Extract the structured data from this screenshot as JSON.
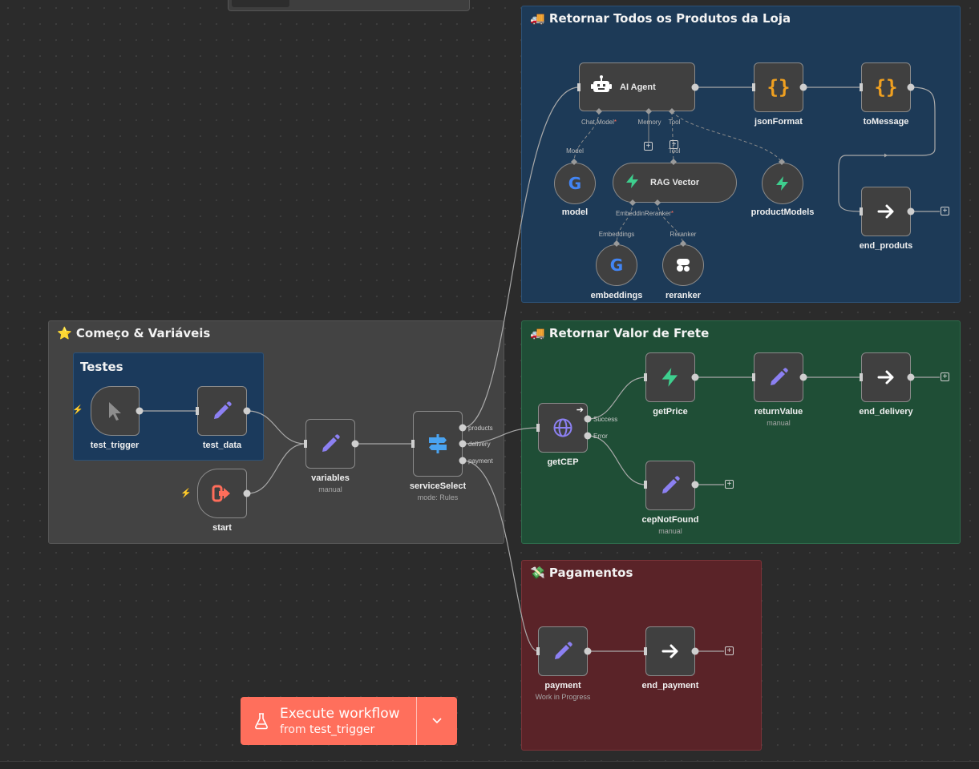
{
  "groups": {
    "products": {
      "emoji": "🚚",
      "title": "Retornar Todos os Produtos da Loja"
    },
    "inicio": {
      "emoji": "⭐",
      "title": "Começo & Variáveis"
    },
    "testes": {
      "title": "Testes"
    },
    "frete": {
      "emoji": "🚚",
      "title": "Retornar Valor de Frete"
    },
    "pagamentos": {
      "emoji": "💸",
      "title": "Pagamentos"
    }
  },
  "nodes": {
    "ai_agent": {
      "label": "AI Agent"
    },
    "json_format": {
      "label": "jsonFormat"
    },
    "to_message": {
      "label": "toMessage"
    },
    "model": {
      "label": "model"
    },
    "rag_vector": {
      "label": "RAG Vector"
    },
    "product_models": {
      "label": "productModels"
    },
    "end_produts": {
      "label": "end_produts"
    },
    "embeddings": {
      "label": "embeddings"
    },
    "reranker": {
      "label": "reranker"
    },
    "test_trigger": {
      "label": "test_trigger"
    },
    "test_data": {
      "label": "test_data"
    },
    "start": {
      "label": "start"
    },
    "variables": {
      "label": "variables",
      "sub": "manual"
    },
    "service_select": {
      "label": "serviceSelect",
      "sub": "mode: Rules"
    },
    "get_cep": {
      "label": "getCEP"
    },
    "get_price": {
      "label": "getPrice"
    },
    "return_value": {
      "label": "returnValue",
      "sub": "manual"
    },
    "end_delivery": {
      "label": "end_delivery"
    },
    "cep_not_found": {
      "label": "cepNotFound",
      "sub": "manual"
    },
    "payment": {
      "label": "payment",
      "sub": "Work in Progress"
    },
    "end_payment": {
      "label": "end_payment"
    }
  },
  "ports": {
    "chat_model": "Chat Model",
    "memory": "Memory",
    "tool": "Tool",
    "model": "Model",
    "tool2": "Tool",
    "embedding": "Embeddin",
    "reranker": "Reranker",
    "embeddings": "Embeddings",
    "reranker2": "Reranker",
    "products": "products",
    "delivery": "delivery",
    "payment": "payment",
    "success": "Success",
    "error": "Error",
    "required_mark": "*"
  },
  "execute": {
    "title": "Execute workflow",
    "from": "from",
    "trigger": "test_trigger"
  },
  "icons": {
    "ai_agent": "robot-icon",
    "json_format": "braces-icon",
    "to_message": "braces-icon",
    "model": "google-icon",
    "rag_vector": "supabase-bolt-icon",
    "product_models": "supabase-bolt-icon",
    "end": "arrow-right-icon",
    "embeddings": "google-icon",
    "reranker": "cohere-icon",
    "test_trigger": "cursor-icon",
    "edit": "pencil-icon",
    "start": "sign-in-icon",
    "service_select": "signpost-icon",
    "get_cep": "globe-icon",
    "execute": "flask-icon"
  },
  "colors": {
    "products_bg": "#1d3a57",
    "frete_bg": "#1f4e36",
    "pagamentos_bg": "#5a2328",
    "inicio_bg": "#434343",
    "testes_bg": "#1b3a5c",
    "accent": "#ff6f5c",
    "pencil": "#8c80f2",
    "braces": "#f0a020",
    "supabase": "#3ecf8e"
  }
}
